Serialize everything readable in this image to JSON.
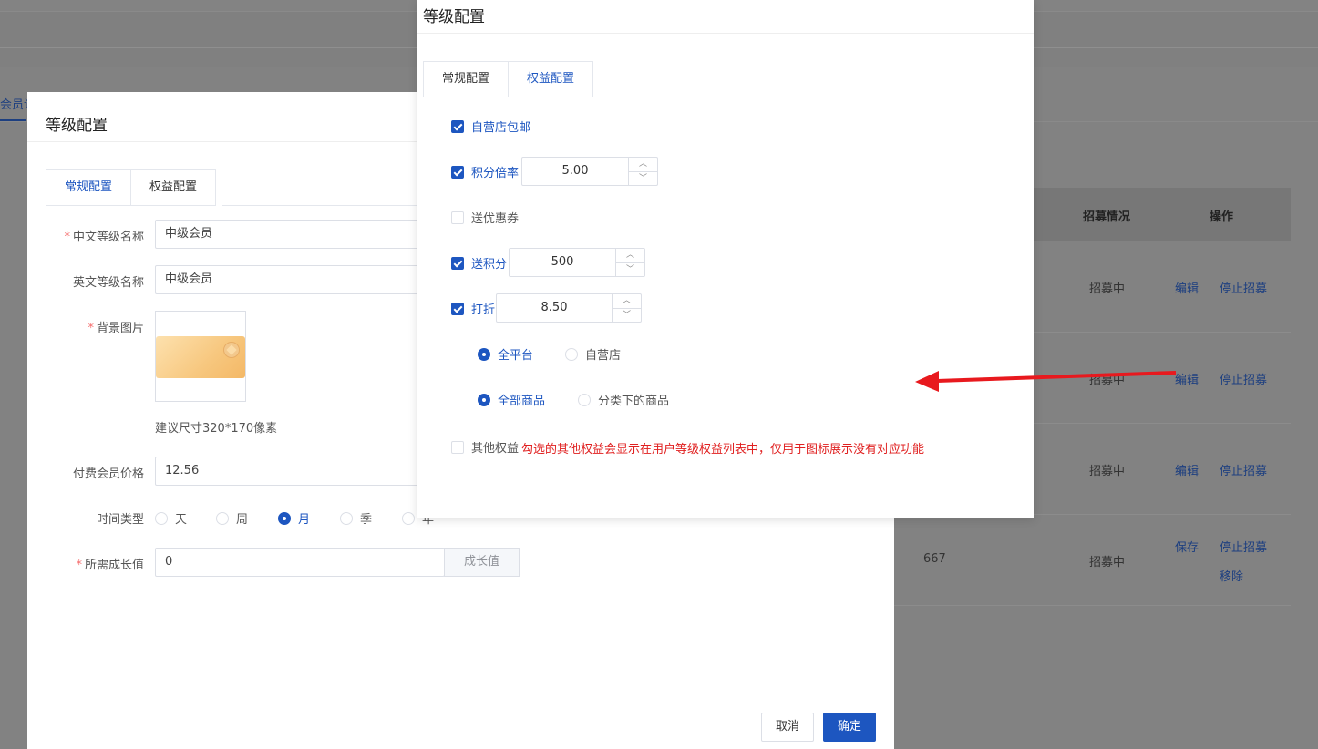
{
  "background": {
    "tab_label": "会员设",
    "columns": [
      "招募情况",
      "操作"
    ],
    "rows": [
      {
        "growth": "",
        "status": "招募中",
        "actions": [
          "编辑",
          "停止招募"
        ]
      },
      {
        "growth": "",
        "status": "招募中",
        "actions": [
          "编辑",
          "停止招募"
        ]
      },
      {
        "growth": "",
        "status": "招募中",
        "actions": [
          "编辑",
          "停止招募"
        ]
      },
      {
        "growth": "667",
        "status": "招募中",
        "actions": [
          "保存",
          "停止招募",
          "移除"
        ]
      }
    ]
  },
  "back_dialog": {
    "title": "等级配置",
    "tabs": [
      "常规配置",
      "权益配置"
    ],
    "fields": {
      "cn_name_label": "中文等级名称",
      "cn_name_value": "中级会员",
      "en_name_label": "英文等级名称",
      "en_name_value": "中级会员",
      "bg_label": "背景图片",
      "bg_hint": "建议尺寸320*170像素",
      "price_label": "付费会员价格",
      "price_value": "12.56",
      "time_type_label": "时间类型",
      "time_options": [
        "天",
        "周",
        "月",
        "季",
        "年"
      ],
      "time_selected": "月",
      "growth_label": "所需成长值",
      "growth_value": "0",
      "growth_append": "成长值"
    },
    "footer": {
      "cancel": "取消",
      "confirm": "确定"
    }
  },
  "front_dialog": {
    "title": "等级配置",
    "tabs": [
      "常规配置",
      "权益配置"
    ],
    "active_tab": "权益配置",
    "benefits": {
      "free_shipping": {
        "label": "自营店包邮",
        "checked": true
      },
      "points_rate": {
        "label": "积分倍率",
        "checked": true,
        "value": "5.00"
      },
      "coupon": {
        "label": "送优惠券",
        "checked": false
      },
      "bonus_points": {
        "label": "送积分",
        "checked": true,
        "value": "500"
      },
      "discount": {
        "label": "打折",
        "checked": true,
        "value": "8.50"
      },
      "scope_options": [
        "全平台",
        "自营店"
      ],
      "scope_selected": "全平台",
      "goods_options": [
        "全部商品",
        "分类下的商品"
      ],
      "goods_selected": "全部商品",
      "other": {
        "label": "其他权益",
        "checked": false,
        "note": "勾选的其他权益会显示在用户等级权益列表中，仅用于图标展示没有对应功能"
      }
    }
  },
  "colors": {
    "primary": "#1d56c0",
    "warning": "#e02020",
    "arrow": "#e8191e"
  }
}
